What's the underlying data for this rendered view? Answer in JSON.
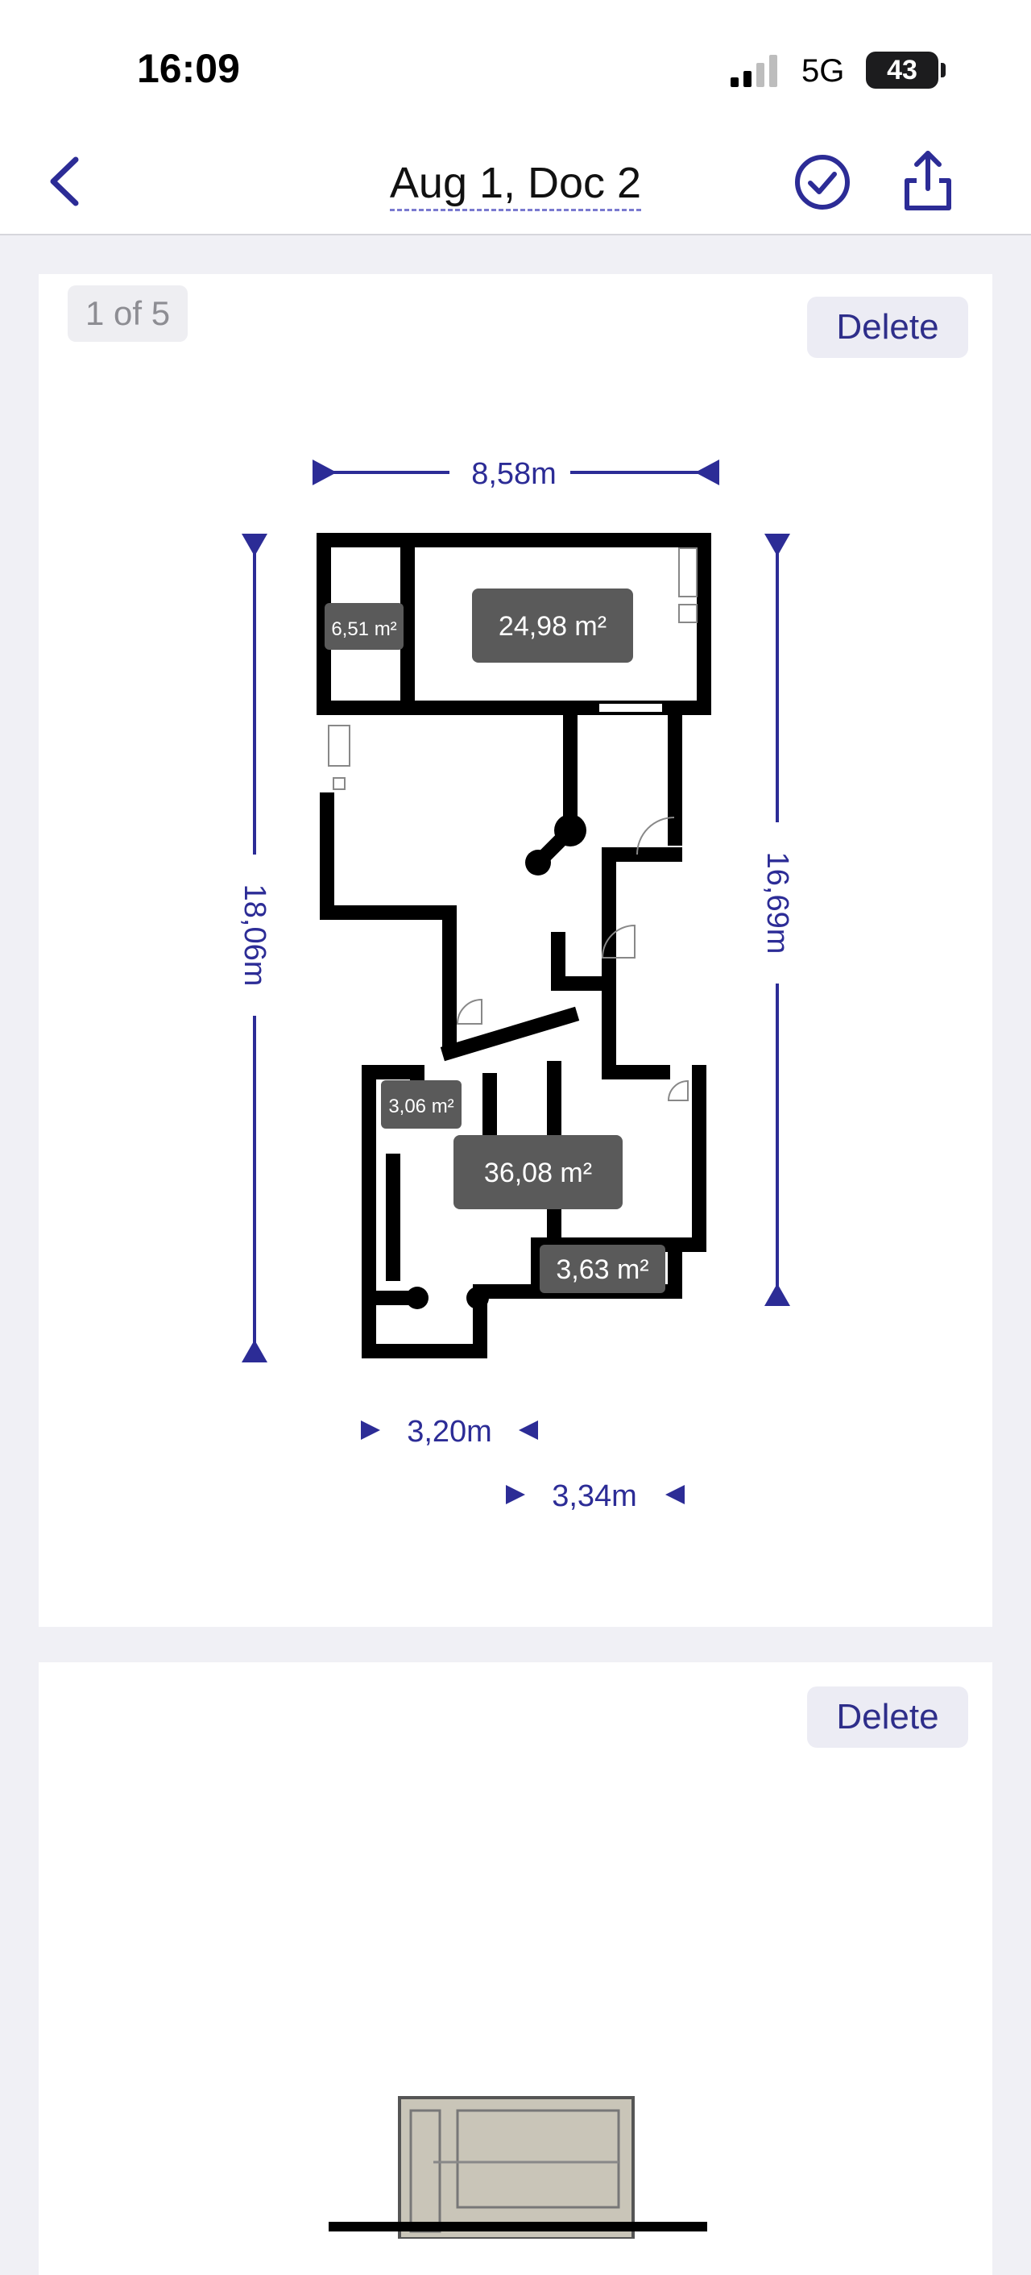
{
  "status": {
    "time": "16:09",
    "network": "5G",
    "battery": "43"
  },
  "nav": {
    "title": "Aug 1, Doc 2"
  },
  "pages": [
    {
      "badge": "1 of 5",
      "delete_label": "Delete",
      "dimensions": {
        "width": "8,58m",
        "height_left": "18,06m",
        "height_right": "16,69m",
        "bottom_1": "3,20m",
        "bottom_2": "3,34m"
      },
      "areas": [
        "6,51 m²",
        "24,98 m²",
        "3,06 m²",
        "36,08 m²",
        "3,63 m²"
      ]
    },
    {
      "delete_label": "Delete"
    }
  ],
  "colors": {
    "accent": "#2c2c96",
    "wall": "#000000",
    "area_badge": "#5a5a5a",
    "background": "#f0f0f5"
  }
}
